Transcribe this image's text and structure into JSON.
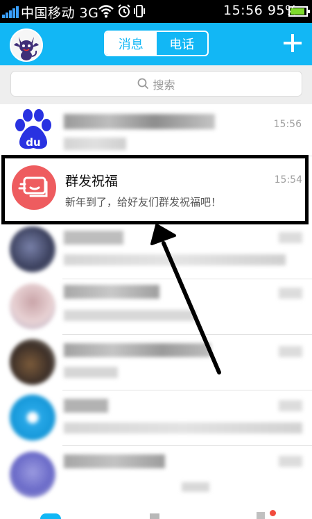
{
  "status_bar": {
    "carrier": "中国移动 3G",
    "time": "15:56",
    "battery": "95%",
    "battery_level": 0.95
  },
  "header": {
    "tabs": [
      {
        "label": "消息",
        "active": true
      },
      {
        "label": "电话",
        "active": false
      }
    ],
    "accent_color": "#12b7f5"
  },
  "search": {
    "placeholder": "搜索"
  },
  "conversations": [
    {
      "time": "15:56",
      "avatar_icon": "baidu-paw-icon"
    },
    {
      "title": "群发祝福",
      "preview": "新年到了，给好友们群发祝福吧！",
      "time": "15:54",
      "avatar_icon": "group-message-icon",
      "avatar_color": "#ee5c5f"
    }
  ]
}
